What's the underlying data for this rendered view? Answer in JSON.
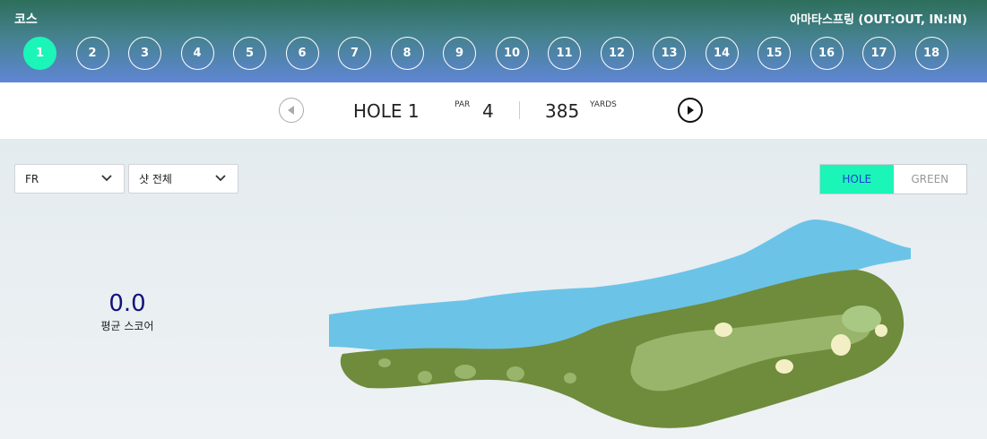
{
  "header": {
    "title": "코스",
    "course_name": "아마타스프링 (OUT:OUT, IN:IN)",
    "holes": [
      "1",
      "2",
      "3",
      "4",
      "5",
      "6",
      "7",
      "8",
      "9",
      "10",
      "11",
      "12",
      "13",
      "14",
      "15",
      "16",
      "17",
      "18"
    ],
    "active_hole": "1",
    "active_color": "#1cf5b8"
  },
  "hole_info": {
    "name": "HOLE 1",
    "par_label": "PAR",
    "par_value": "4",
    "yards_value": "385",
    "yards_label": "YARDS",
    "prev_icon": "prev-arrow-icon",
    "next_icon": "next-arrow-icon"
  },
  "filters": {
    "tee": "FR",
    "shot": "샷 전체"
  },
  "view_toggle": {
    "hole_label": "HOLE",
    "green_label": "GREEN",
    "selected": "HOLE"
  },
  "stats": {
    "avg_score_value": "0.0",
    "avg_score_label": "평균 스코어"
  },
  "colors": {
    "water": "#6cc3e8",
    "rough": "#6f8b3c",
    "fairway": "#98b56b",
    "bunker": "#f3efc5"
  }
}
